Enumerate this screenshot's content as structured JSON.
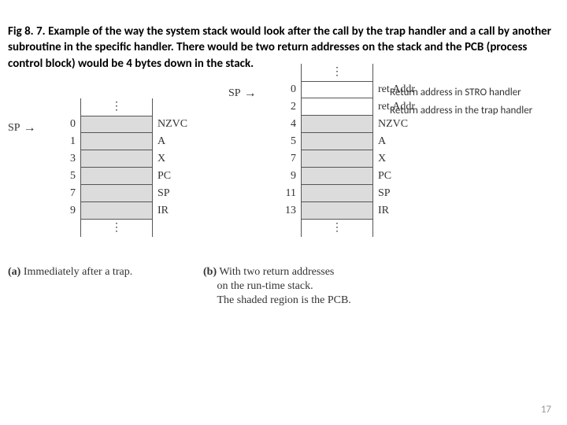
{
  "caption": "Fig 8. 7.  Example of the way the system stack would look after the call by the trap handler and a call by another subroutine in the specific  handler.  There would be two return addresses on the stack and the PCB (process control block) would be 4 bytes down in the stack.",
  "sp_label": "SP",
  "diagrams": {
    "a": {
      "rows": [
        {
          "offset": "0",
          "label": "NZVC"
        },
        {
          "offset": "1",
          "label": "A"
        },
        {
          "offset": "3",
          "label": "X"
        },
        {
          "offset": "5",
          "label": "PC"
        },
        {
          "offset": "7",
          "label": "SP"
        },
        {
          "offset": "9",
          "label": "IR"
        }
      ],
      "subcaption_bold": "(a)",
      "subcaption_rest": "Immediately after a trap."
    },
    "b": {
      "rows": [
        {
          "offset": "0",
          "label": "ret.Addr"
        },
        {
          "offset": "2",
          "label": "ret.Addr"
        },
        {
          "offset": "4",
          "label": "NZVC"
        },
        {
          "offset": "5",
          "label": "A"
        },
        {
          "offset": "7",
          "label": "X"
        },
        {
          "offset": "9",
          "label": "PC"
        },
        {
          "offset": "11",
          "label": "SP"
        },
        {
          "offset": "13",
          "label": "IR"
        }
      ],
      "subcaption_bold": "(b)",
      "subcaption_rest_l1": "With two return addresses",
      "subcaption_rest_l2": "on the run-time stack.",
      "subcaption_rest_l3": "The shaded region is the PCB."
    }
  },
  "annotations": {
    "anno1": "Return address in STRO handler",
    "anno2": "Return address in the trap handler"
  },
  "page": "17"
}
